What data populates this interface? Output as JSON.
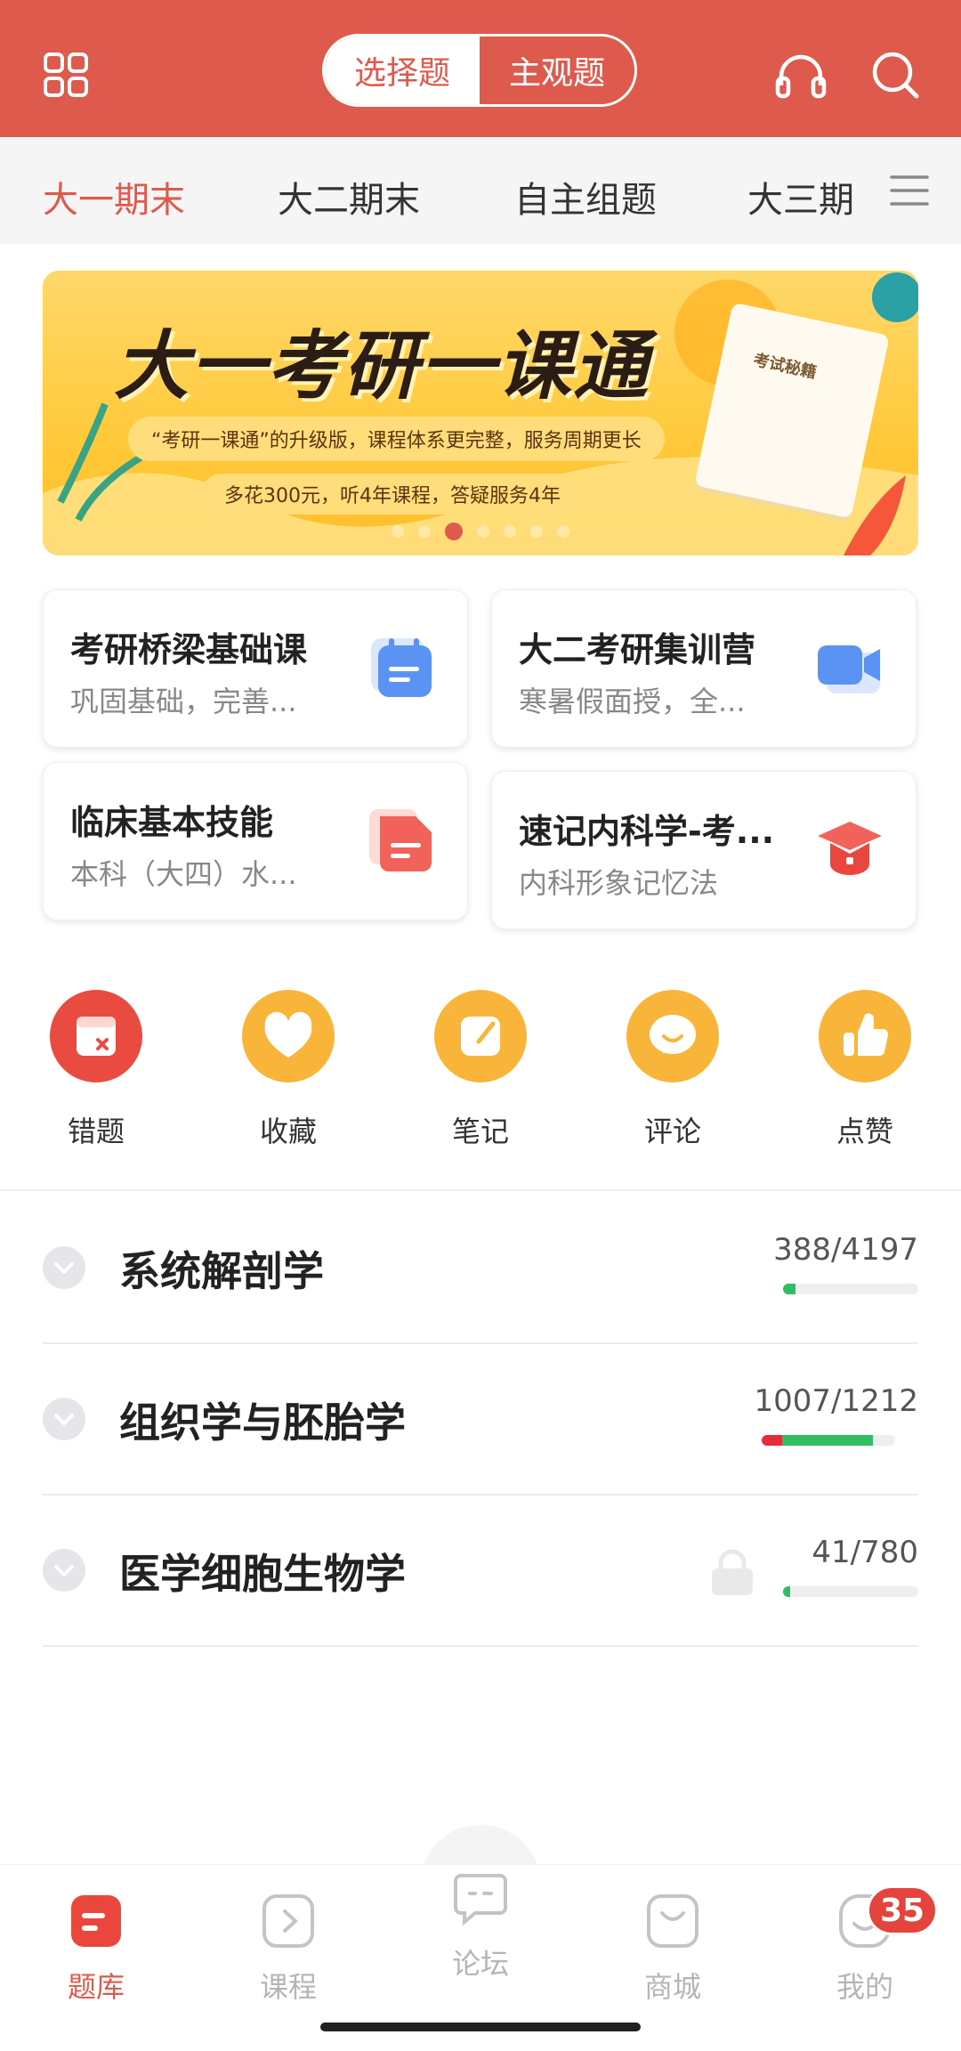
{
  "header": {
    "segment": {
      "active": "选择题",
      "inactive": "主观题"
    },
    "icons": [
      "grid-icon",
      "headphones-icon",
      "search-icon"
    ]
  },
  "tabs": [
    "大一期末",
    "大二期末",
    "自主组题",
    "大三期"
  ],
  "banner": {
    "title": "大一考研一课通",
    "line1": "“考研一课通”的升级版，课程体系更完整，服务周期更长",
    "line2": "多花300元，听4年课程，答疑服务4年",
    "note_title": "考试秘籍",
    "page_count": 7,
    "active_page": 3
  },
  "cards": [
    {
      "title": "考研桥梁基础课",
      "subtitle": "巩固基础，完善...",
      "icon": "calendar-icon"
    },
    {
      "title": "大二考研集训营",
      "subtitle": "寒暑假面授，全...",
      "icon": "video-icon"
    },
    {
      "title": "临床基本技能",
      "subtitle": "本科（大四）水...",
      "icon": "document-icon"
    },
    {
      "title": "速记内科学-考...",
      "subtitle": "内科形象记忆法",
      "icon": "graduation-cap-icon"
    }
  ],
  "quick_actions": [
    {
      "label": "错题",
      "color": "#e94b40"
    },
    {
      "label": "收藏",
      "color": "#f9b53a"
    },
    {
      "label": "笔记",
      "color": "#f9b53a"
    },
    {
      "label": "评论",
      "color": "#f9b53a"
    },
    {
      "label": "点赞",
      "color": "#f9b53a"
    }
  ],
  "subjects": [
    {
      "name": "系统解剖学",
      "count": "388/4197",
      "wrong_fraction": 0.0,
      "done_fraction": 0.09,
      "locked": false
    },
    {
      "name": "组织学与胚胎学",
      "count": "1007/1212",
      "wrong_fraction": 0.15,
      "done_fraction": 0.83,
      "locked": false
    },
    {
      "name": "医学细胞生物学",
      "count": "41/780",
      "wrong_fraction": 0.0,
      "done_fraction": 0.05,
      "locked": true
    }
  ],
  "bottom_nav": {
    "items": [
      "题库",
      "课程",
      "论坛",
      "商城",
      "我的"
    ],
    "active": "题库",
    "badge": "35"
  },
  "colors": {
    "primary": "#de5a4c",
    "accent_yellow": "#f9b53a",
    "progress_green": "#2fbe62",
    "progress_red": "#e52d3a"
  }
}
